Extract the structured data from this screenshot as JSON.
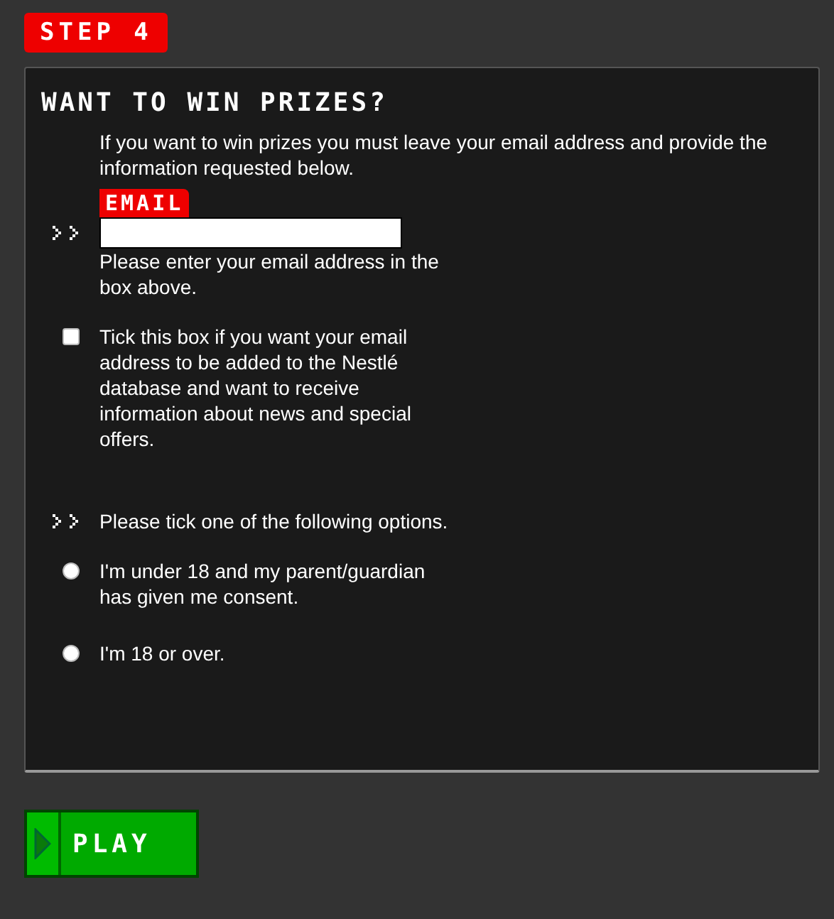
{
  "step_badge": "STEP 4",
  "heading": "WANT TO WIN PRIZES?",
  "intro": "If you want to win prizes you must leave your email address and provide the information requested below.",
  "email": {
    "label": "EMAIL",
    "hint": "Please enter your email address in the box above."
  },
  "newsletter": {
    "label": "Tick this box if you want your email address to be added to the Nestlé database and want to receive information about news and special offers.",
    "checked": false
  },
  "options_prompt": "Please tick one of the following options.",
  "age_options": [
    {
      "label": "I'm under 18 and my parent/guardian has given me consent.",
      "selected": false
    },
    {
      "label": "I'm 18 or over.",
      "selected": false
    }
  ],
  "play_button": "PLAY"
}
